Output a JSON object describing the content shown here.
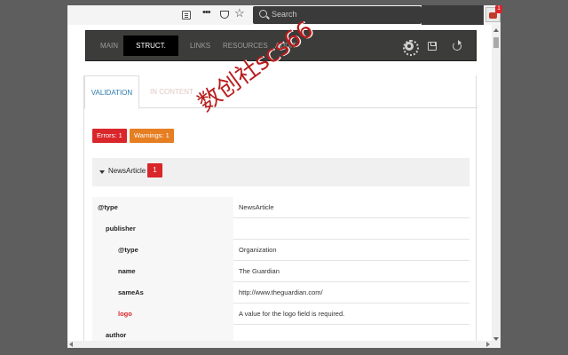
{
  "browser": {
    "search_placeholder": "Search",
    "extension_badge": "1"
  },
  "nav": {
    "tabs": [
      "MAIN",
      "STRUCT. DATA",
      "LINKS",
      "RESOURCES",
      "AUDIT"
    ],
    "active": "STRUCT. DATA"
  },
  "subtabs": [
    "VALIDATION",
    "IN CONTENT"
  ],
  "badges": {
    "errors": "Errors: 1",
    "warnings": "Warnings: 1"
  },
  "article": {
    "label": "NewsArticle",
    "count": "1"
  },
  "table": {
    "rows": [
      {
        "key": "@type",
        "value": "NewsArticle"
      },
      {
        "key": "publisher",
        "value": ""
      },
      {
        "key": "@type",
        "value": "Organization"
      },
      {
        "key": "name",
        "value": "The Guardian"
      },
      {
        "key": "sameAs",
        "value": "http://www.theguardian.com/"
      },
      {
        "key": "logo",
        "value": "A value for the logo field is required."
      },
      {
        "key": "author",
        "value": ""
      }
    ]
  },
  "watermark": "数创社scs66",
  "colors": {
    "error": "#d9262b",
    "warning": "#e67e22",
    "active_tab": "#2a7ab0",
    "nav_bg": "#3c3c3a"
  }
}
